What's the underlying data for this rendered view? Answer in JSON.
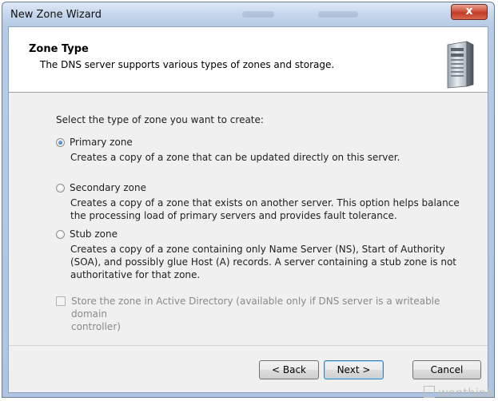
{
  "window": {
    "title": "New Zone Wizard",
    "close_label": "x"
  },
  "header": {
    "title": "Zone Type",
    "subtitle": "The DNS server supports various types of zones and storage."
  },
  "body": {
    "prompt": "Select the type of zone you want to create:",
    "options": [
      {
        "label": "Primary zone",
        "checked": true,
        "description": [
          "Creates a copy of a zone that can be updated directly on this server."
        ]
      },
      {
        "label": "Secondary zone",
        "checked": false,
        "description": [
          "Creates a copy of a zone that exists on another server. This option helps balance",
          "the processing load of primary servers and provides fault tolerance."
        ]
      },
      {
        "label": "Stub zone",
        "checked": false,
        "description": [
          "Creates a copy of a zone containing only Name Server (NS), Start of Authority",
          "(SOA), and possibly glue Host (A) records. A server containing a stub zone is not",
          "authoritative for that zone."
        ]
      }
    ],
    "ad_checkbox": {
      "checked": false,
      "enabled": false,
      "label_lines": [
        "Store the zone in Active Directory (available only if DNS server is a writeable domain",
        "controller)"
      ]
    }
  },
  "footer": {
    "back_label": "< Back",
    "next_label": "Next >",
    "cancel_label": "Cancel"
  },
  "watermark": "wenthink",
  "icons": {
    "server": "server-tower-icon",
    "close": "close-icon"
  },
  "colors": {
    "titlebar": "#c5d6ec",
    "close_button": "#c94a33",
    "client_bg": "#f0f0f0",
    "radio_dot": "#1f5fa8",
    "disabled_text": "#8a8a8a"
  }
}
